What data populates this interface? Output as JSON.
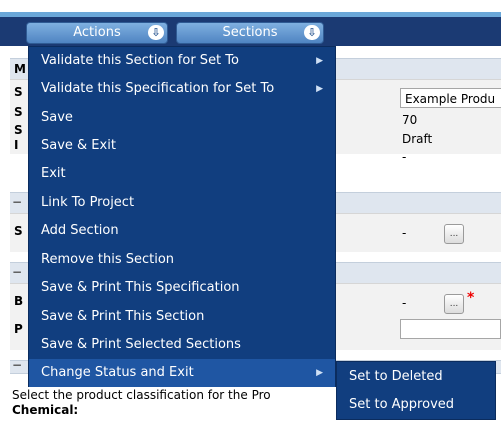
{
  "toolbar": {
    "actions_label": "Actions",
    "sections_label": "Sections",
    "arrow_glyph": "⇩"
  },
  "background": {
    "label_m": "M",
    "label_s1": "S",
    "label_s2": "S",
    "label_s3": "S",
    "label_i": "I",
    "label_s4": "S",
    "label_b": "B",
    "label_p": "P",
    "name_value": "Example Produ",
    "val_70": "70",
    "val_draft": "Draft",
    "val_dash1": "-",
    "val_dash2": "-",
    "val_dash3": "-",
    "dots": "...",
    "required_mark": "*",
    "section_collapse": "−",
    "bottom_text": "Select the product classification for the Pro",
    "chemical_label": "Chemical:"
  },
  "menu": {
    "items": [
      {
        "label": "Validate this Section for Set To",
        "submenu": true
      },
      {
        "label": "Validate this Specification for Set To",
        "submenu": true
      },
      {
        "label": "Save",
        "submenu": false
      },
      {
        "label": "Save & Exit",
        "submenu": false
      },
      {
        "label": "Exit",
        "submenu": false
      },
      {
        "label": "Link To Project",
        "submenu": false
      },
      {
        "label": "Add Section",
        "submenu": false
      },
      {
        "label": "Remove this Section",
        "submenu": false
      },
      {
        "label": "Save & Print This Specification",
        "submenu": false
      },
      {
        "label": "Save & Print This Section",
        "submenu": false
      },
      {
        "label": "Save & Print Selected Sections",
        "submenu": false
      },
      {
        "label": "Change Status and Exit",
        "submenu": true
      }
    ],
    "submenu_arrow": "▶"
  },
  "status_submenu": {
    "items": [
      {
        "label": "Set to Deleted"
      },
      {
        "label": "Set to Approved"
      }
    ]
  },
  "colors": {
    "menu_bg": "#113e7f",
    "menu_highlight": "#1f56a3",
    "toolbar_bg": "#1b3a73"
  }
}
